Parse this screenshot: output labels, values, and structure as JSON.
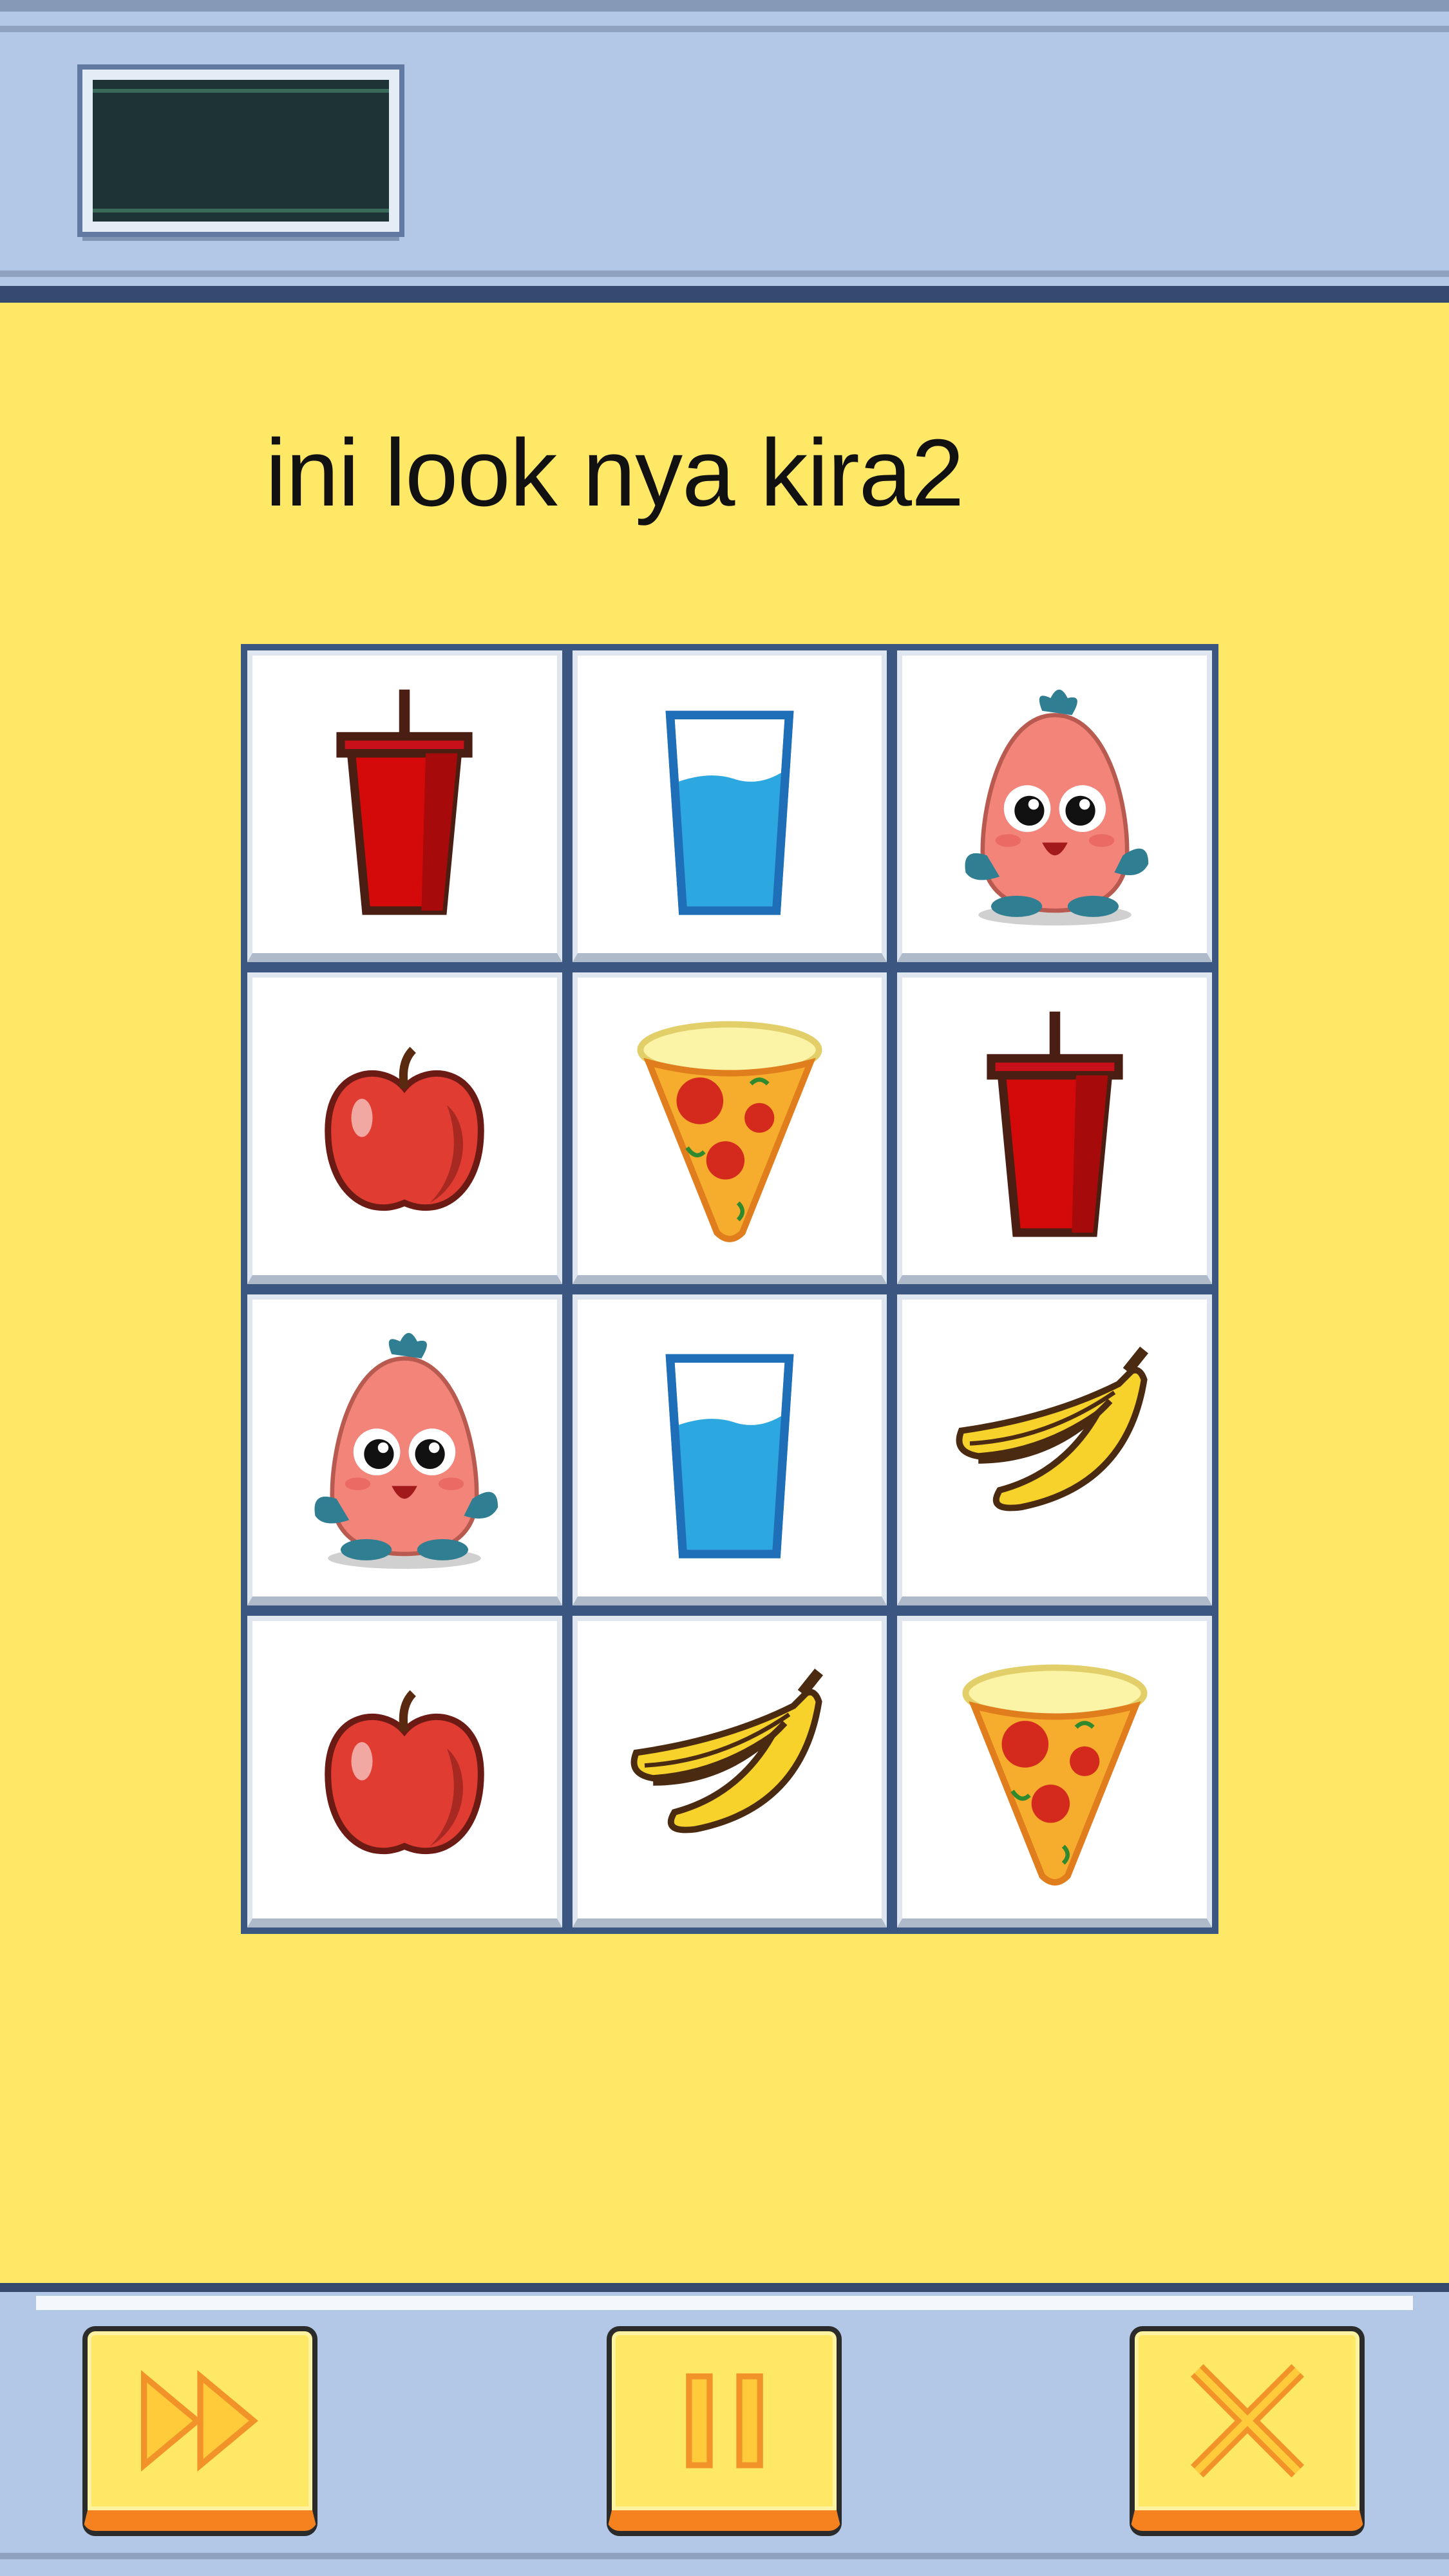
{
  "hud": {
    "score": ""
  },
  "caption": "ini look nya kira2",
  "grid": {
    "rows": 4,
    "cols": 3,
    "tiles": [
      {
        "icon": "soda-cup-icon"
      },
      {
        "icon": "water-glass-icon"
      },
      {
        "icon": "pink-blob-character-icon"
      },
      {
        "icon": "apple-icon"
      },
      {
        "icon": "pizza-slice-icon"
      },
      {
        "icon": "soda-cup-icon"
      },
      {
        "icon": "pink-blob-character-icon"
      },
      {
        "icon": "water-glass-icon"
      },
      {
        "icon": "banana-icon"
      },
      {
        "icon": "apple-icon"
      },
      {
        "icon": "banana-icon"
      },
      {
        "icon": "pizza-slice-icon"
      }
    ]
  },
  "controls": {
    "fast_forward": {
      "icon": "fast-forward-icon"
    },
    "pause": {
      "icon": "pause-icon"
    },
    "close": {
      "icon": "close-icon"
    }
  },
  "colors": {
    "background": "#ffe866",
    "bar": "#b3c7e6",
    "bar_dark": "#364a70",
    "grid_frame": "#3b5680",
    "button_face": "#ffe866",
    "button_accent": "#f6821f"
  }
}
